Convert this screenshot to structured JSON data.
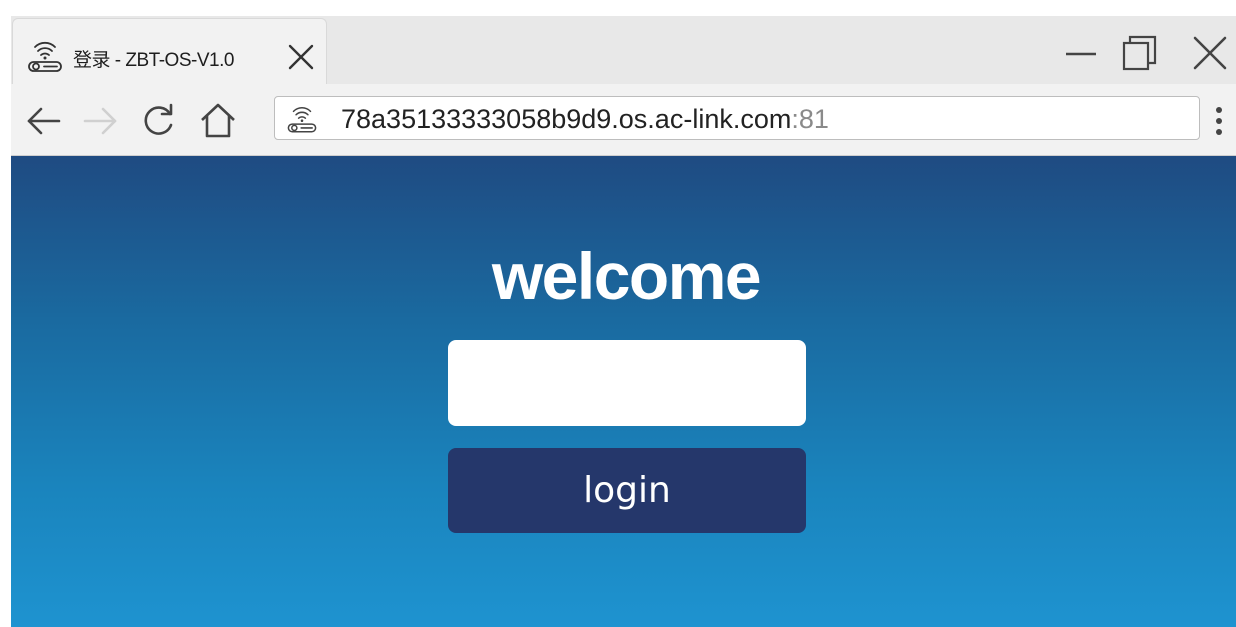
{
  "browser": {
    "tab": {
      "title": "登录 - ZBT-OS-V1.0",
      "icon": "router-wifi-icon"
    },
    "toolbar": {
      "icons": [
        "back-arrow-icon",
        "forward-arrow-icon",
        "reload-icon",
        "home-icon",
        "kebab-menu-icon"
      ],
      "site_icon": "router-wifi-icon",
      "url_host": "78a35133333058b9d9.os.ac-link.com",
      "url_port": ":81"
    },
    "window_controls": [
      "minimize-icon",
      "restore-icon",
      "close-icon"
    ]
  },
  "page": {
    "heading": "welcome",
    "password": {
      "value": "",
      "placeholder": ""
    },
    "login_label": "login",
    "colors": {
      "background_top": "#1f4b82",
      "background_bottom": "#1e93d0",
      "button": "#25376b",
      "text": "#ffffff"
    }
  }
}
